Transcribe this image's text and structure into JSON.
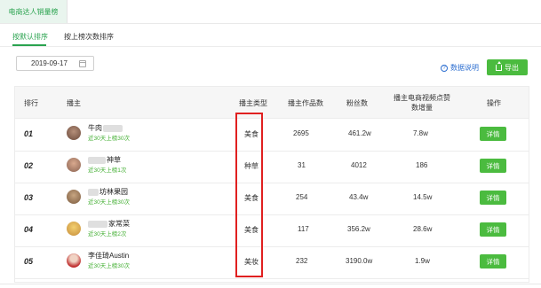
{
  "top_tab": "电商达人销量榜",
  "sub_tabs": [
    "按默认排序",
    "按上榜次数排序"
  ],
  "date": "2019-09-17",
  "help_text": "数据说明",
  "export_label": "导出",
  "accent_color": "#4bbb3f",
  "columns": [
    "排行",
    "播主",
    "播主类型",
    "播主作品数",
    "粉丝数",
    "播主电商视频点赞数增量",
    "操作"
  ],
  "rows": [
    {
      "rank": "01",
      "name": "牛肉",
      "sub": "近30天上榜30次",
      "type": "美食",
      "works": "2695",
      "fans": "461.2w",
      "likes": "7.8w",
      "action": "详情"
    },
    {
      "rank": "02",
      "name": "神草",
      "sub": "近30天上榜1次",
      "type": "种草",
      "works": "31",
      "fans": "4012",
      "likes": "186",
      "action": "详情"
    },
    {
      "rank": "03",
      "name": "坊林果园",
      "sub": "近30天上榜30次",
      "type": "美食",
      "works": "254",
      "fans": "43.4w",
      "likes": "14.5w",
      "action": "详情"
    },
    {
      "rank": "04",
      "name": "家常菜",
      "sub": "近30天上榜2次",
      "type": "美食",
      "works": "117",
      "fans": "356.2w",
      "likes": "28.6w",
      "action": "详情"
    },
    {
      "rank": "05",
      "name": "李佳琦Austin",
      "sub": "近30天上榜30次",
      "type": "美妆",
      "works": "232",
      "fans": "3190.0w",
      "likes": "1.9w",
      "action": "详情"
    }
  ]
}
